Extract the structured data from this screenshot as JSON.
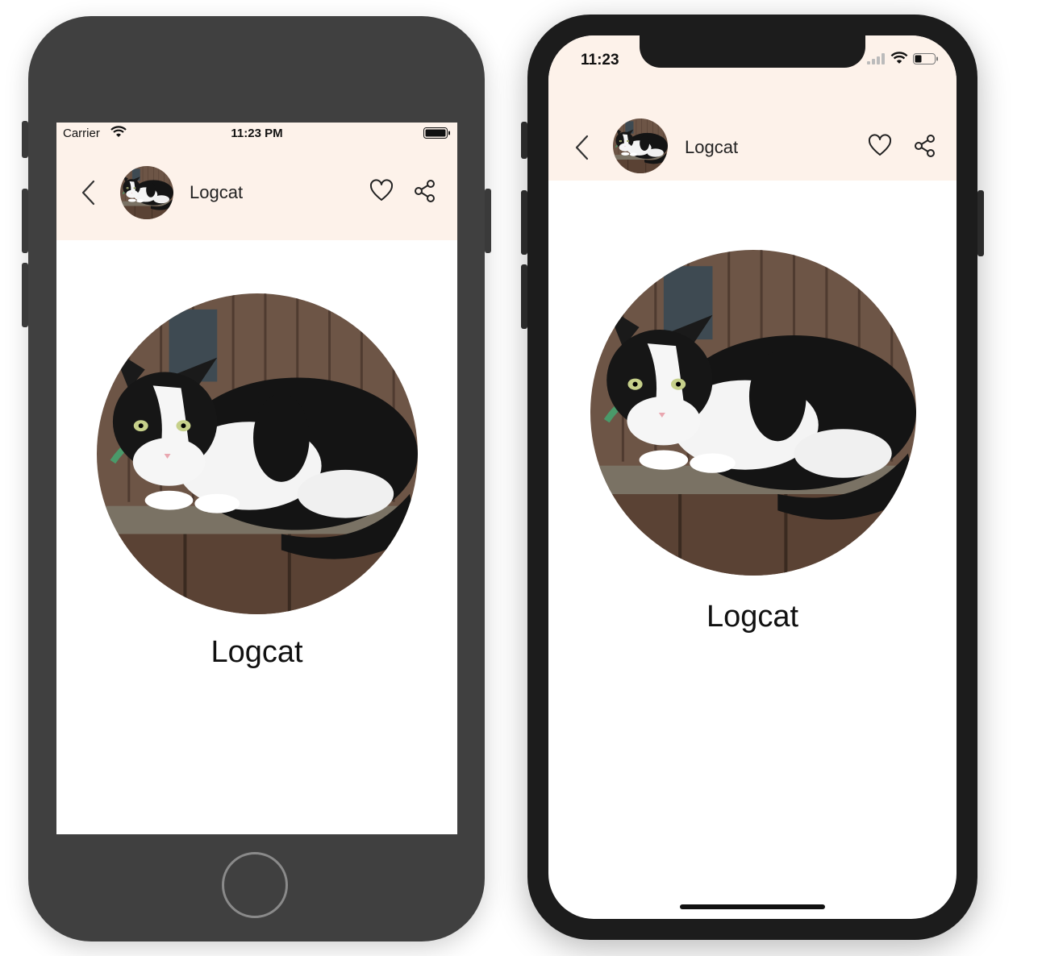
{
  "phone_left": {
    "status_bar": {
      "carrier": "Carrier",
      "time": "11:23 PM"
    },
    "nav": {
      "title": "Logcat"
    },
    "profile": {
      "name": "Logcat"
    }
  },
  "phone_right": {
    "status_bar": {
      "time": "11:23"
    },
    "nav": {
      "title": "Logcat"
    },
    "profile": {
      "name": "Logcat"
    }
  },
  "colors": {
    "header_bg": "#fdf2ea",
    "device_light": "#404040",
    "device_dark": "#1c1c1c"
  },
  "icons": [
    "back-chevron-icon",
    "heart-icon",
    "share-icon",
    "wifi-icon",
    "battery-icon",
    "signal-icon"
  ]
}
